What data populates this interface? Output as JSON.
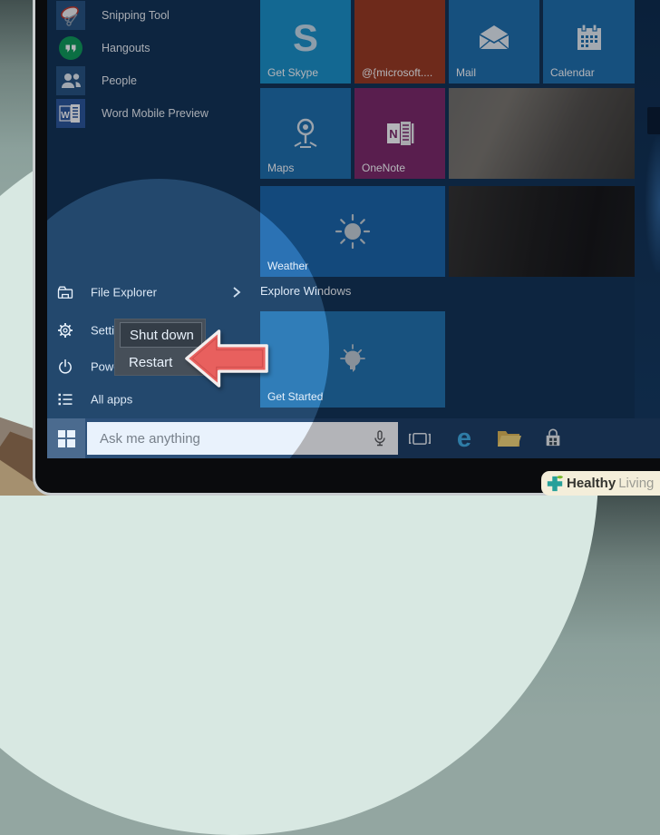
{
  "app_list": {
    "items": [
      {
        "label": "Snipping Tool"
      },
      {
        "label": "Hangouts"
      },
      {
        "label": "People"
      },
      {
        "label": "Word Mobile Preview"
      }
    ]
  },
  "tiles": {
    "get_skype": {
      "label": "Get Skype"
    },
    "microsoft": {
      "label": "@{microsoft...."
    },
    "mail": {
      "label": "Mail"
    },
    "calendar": {
      "label": "Calendar"
    },
    "maps": {
      "label": "Maps"
    },
    "onenote": {
      "label": "OneNote"
    },
    "weather": {
      "label": "Weather"
    },
    "get_started": {
      "label": "Get Started"
    }
  },
  "sections": {
    "explore_windows": "Explore Windows"
  },
  "left_menu": {
    "file_explorer": "File Explorer",
    "settings": "Settings",
    "power": "Power",
    "all_apps": "All apps"
  },
  "context_menu": {
    "items": [
      "Shut down",
      "Restart"
    ]
  },
  "taskbar": {
    "search_placeholder": "Ask me anything"
  },
  "watermark": {
    "bold": "Healthy",
    "light": "Living"
  },
  "glyphs": {
    "skype": "S",
    "word": "W",
    "onenote": "N",
    "edge": "e"
  },
  "icons": [
    "snipping-tool-icon",
    "hangouts-icon",
    "people-icon",
    "word-icon",
    "skype-icon",
    "mail-icon",
    "calendar-icon",
    "maps-pin-icon",
    "onenote-icon",
    "weather-sun-icon",
    "lightbulb-icon",
    "file-explorer-icon",
    "gear-icon",
    "power-icon",
    "all-apps-icon",
    "chevron-right-icon",
    "windows-start-icon",
    "microphone-icon",
    "task-view-icon",
    "edge-icon",
    "folder-icon",
    "store-icon",
    "healthy-living-cross-icon"
  ],
  "colors": {
    "screen_bg": "#123353",
    "accent_tile": "#1f70ad",
    "skype_tile": "#1b93c9",
    "microsoft_tile": "#9c3a1f",
    "onenote_tile": "#7e2968",
    "weather_tile": "#1b66a9",
    "taskbar": "#1d3e63",
    "context_menu_bg": "#3c3c3c",
    "arrow_red": "#e8605e",
    "logo_teal": "#27a09a",
    "logo_leaf": "#76b82a"
  }
}
